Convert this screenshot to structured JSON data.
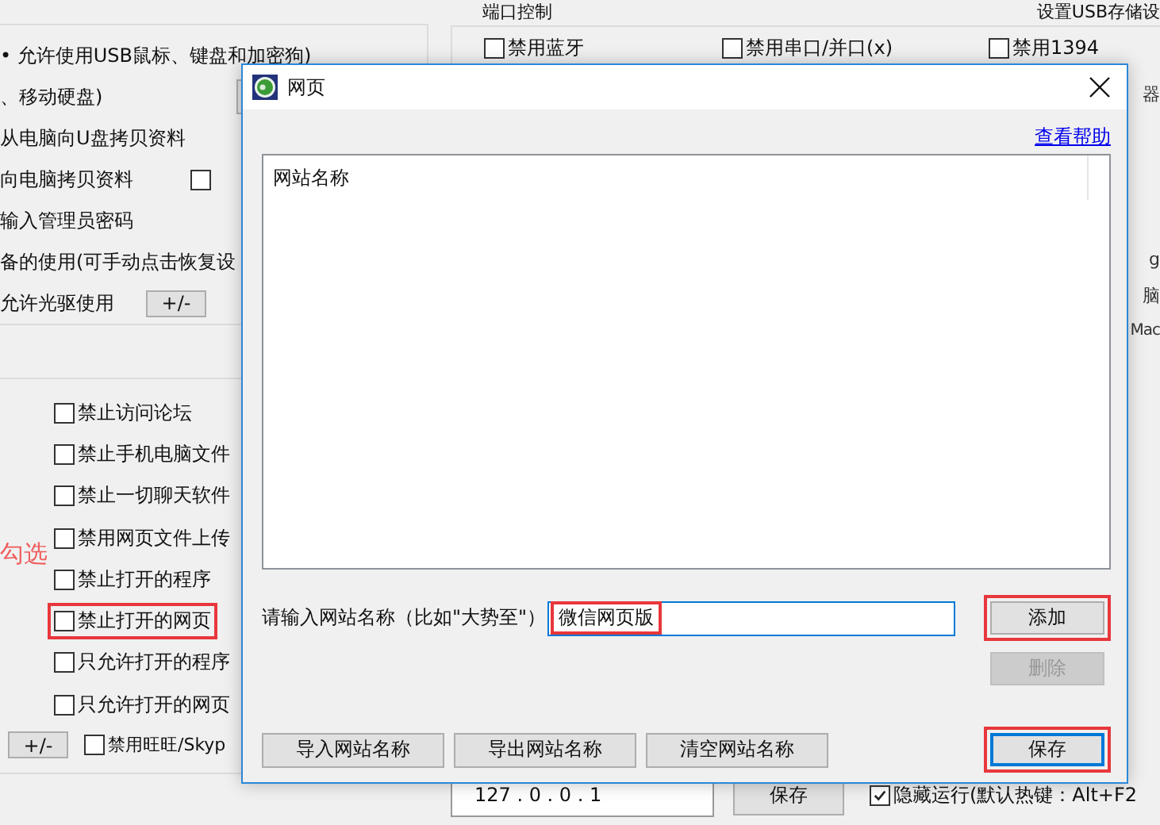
{
  "background": {
    "left_lines": [
      {
        "text": "• 允许使用USB鼠标、键盘和加密狗)",
        "kind": "plain"
      },
      {
        "text": "、移动硬盘)",
        "kind": "stub"
      },
      {
        "text": "从电脑向U盘拷贝资料",
        "kind": "plain"
      },
      {
        "text": "向电脑拷贝资料",
        "kind": "checkbox",
        "checked": false
      },
      {
        "text": "输入管理员密码",
        "kind": "plain"
      },
      {
        "text": "备的使用(可手动点击恢复设",
        "kind": "plain"
      },
      {
        "text": "允许光驱使用",
        "kind": "button",
        "button": "+/-"
      }
    ],
    "checkboxes": [
      {
        "label": "禁止访问论坛",
        "checked": false,
        "highlighted": false
      },
      {
        "label": "禁止手机电脑文件",
        "checked": false,
        "highlighted": false
      },
      {
        "label": "禁止一切聊天软件",
        "checked": false,
        "highlighted": false
      },
      {
        "label": "禁用网页文件上传",
        "checked": false,
        "highlighted": false
      },
      {
        "label": "禁止打开的程序",
        "checked": false,
        "highlighted": false
      },
      {
        "label": "禁止打开的网页",
        "checked": false,
        "highlighted": true
      },
      {
        "label": "只允许打开的程序",
        "checked": false,
        "highlighted": false
      },
      {
        "label": "只允许打开的网页",
        "checked": false,
        "highlighted": false
      }
    ],
    "annotation": "勾选",
    "bottom_button": "+/-",
    "bottom_checkbox": {
      "label": "禁用旺旺/Skyp",
      "checked": false
    },
    "right_title": "端口控制",
    "right_title_end": "设置USB存储设",
    "right_checkboxes": [
      {
        "label": "禁用蓝牙",
        "checked": false
      },
      {
        "label": "禁用串口/并口(x)",
        "checked": false
      },
      {
        "label": "禁用1394",
        "checked": false
      }
    ],
    "right_fragments": [
      "器",
      "g",
      "脑",
      "Mac"
    ],
    "ip_field": "127 . 0 . 0 . 1",
    "ip_save": "保存",
    "hide_run": {
      "label": "隐藏运行(默认热键：Alt+F2",
      "checked": true
    }
  },
  "dialog": {
    "title": "网页",
    "help_link": "查看帮助",
    "list": {
      "column": "网站名称"
    },
    "input_label": "请输入网站名称（比如\"大势至\"）",
    "input": {
      "value": "微信网页版",
      "highlighted": true
    },
    "add_button": {
      "label": "添加",
      "highlighted": true,
      "disabled": false
    },
    "delete_button": {
      "label": "删除",
      "disabled": true
    },
    "bottom_buttons": [
      "导入网站名称",
      "导出网站名称",
      "清空网站名称"
    ],
    "save_button": {
      "label": "保存",
      "highlighted": true,
      "focused": true
    }
  }
}
